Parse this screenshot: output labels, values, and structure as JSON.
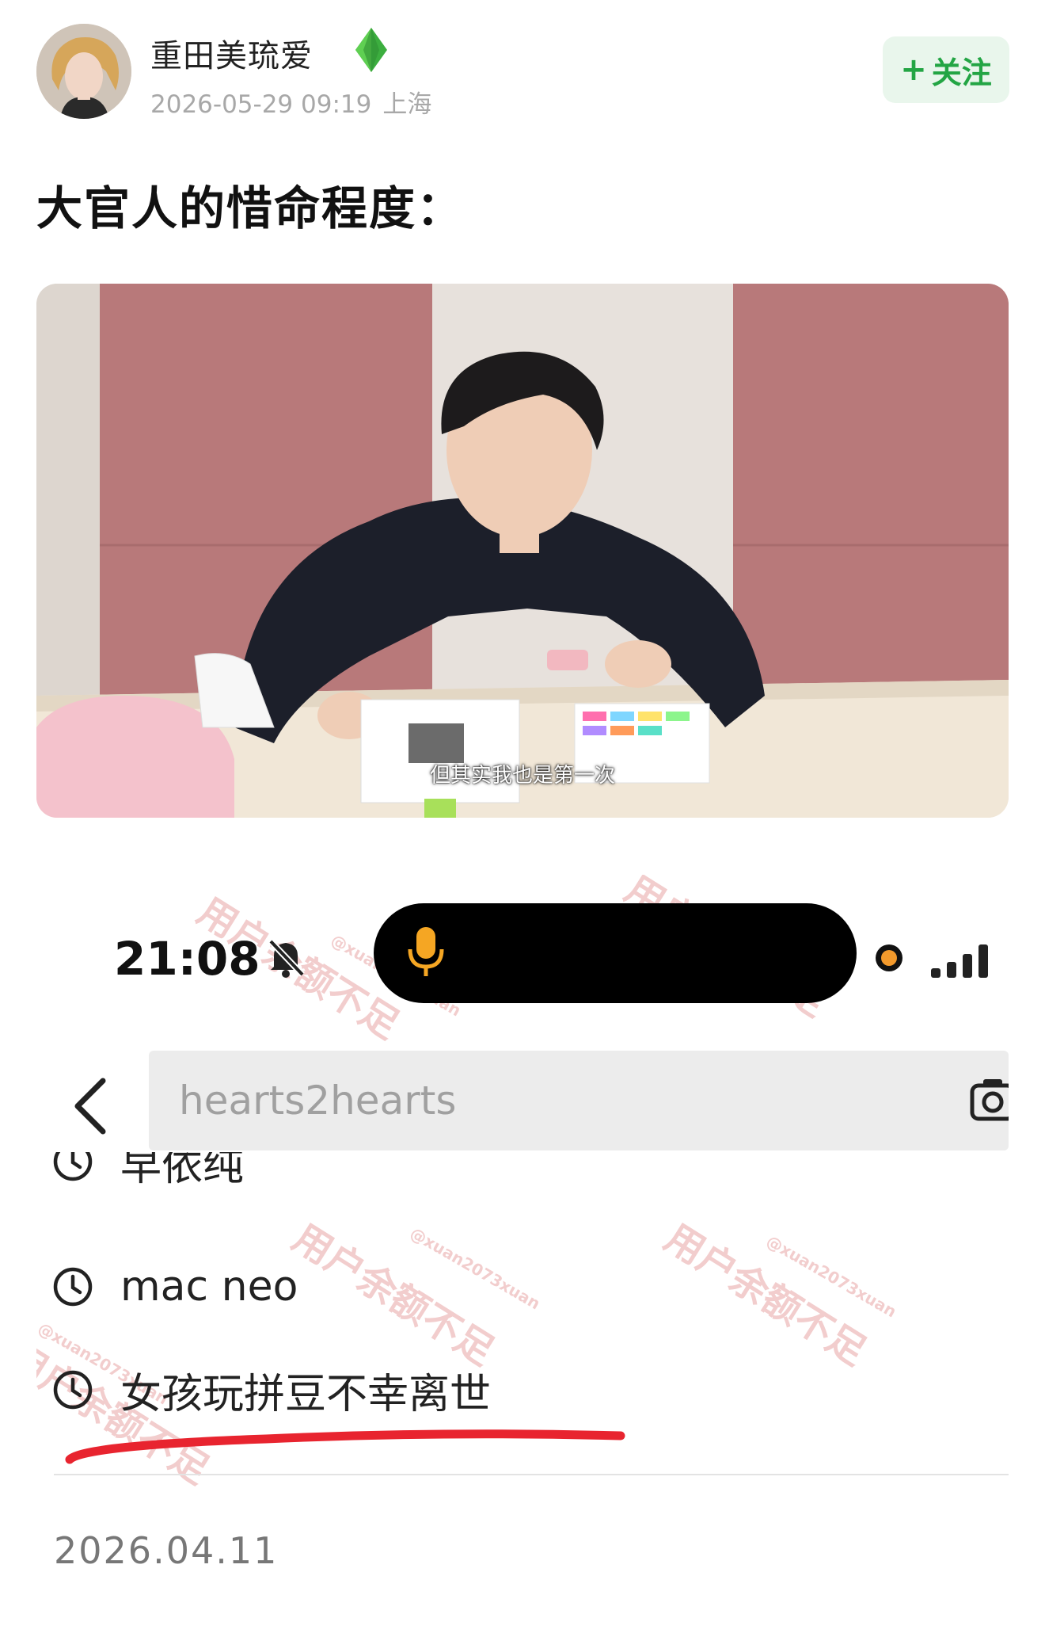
{
  "author": {
    "name": "重田美琉爱",
    "date": "2026-05-29 09:19",
    "location": "上海",
    "badge_icon": "green-gem-icon"
  },
  "follow_button": {
    "plus": "+",
    "label": "关注"
  },
  "post": {
    "text": "大官人的惜命程度："
  },
  "image1": {
    "caption": "但其实我也是第一次"
  },
  "image2": {
    "status_time": "21:08",
    "search_query": "hearts2hearts",
    "history": [
      {
        "label": "早依纯"
      },
      {
        "label": "mac neo"
      },
      {
        "label": "女孩玩拼豆不幸离世"
      }
    ],
    "date_partial": "2026.04.11",
    "watermarks": {
      "balance": "用户余额不足",
      "handle": "@xuan2073xuan"
    }
  },
  "colors": {
    "follow_bg": "#e9f6ec",
    "follow_text": "#23a544",
    "underline": "#e8242f",
    "recording_dot": "#f39a2c",
    "mic": "#f5a623"
  }
}
